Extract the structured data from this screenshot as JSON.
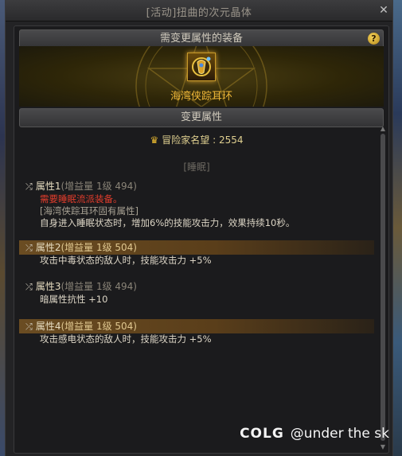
{
  "window": {
    "title": "[活动]扭曲的次元晶体",
    "close_icon": "close-x-icon"
  },
  "equip_section": {
    "header": "需变更属性的装备",
    "help_label": "?"
  },
  "item": {
    "name": "海湾侠踪耳环",
    "icon": "earring-icon",
    "name_color": "#f0b838"
  },
  "change_section": {
    "header": "变更属性"
  },
  "fame": {
    "label": "冒险家名望 : 2554",
    "icon": "fame-icon"
  },
  "sleep_tag": "[睡眠]",
  "attributes": [
    {
      "name": "属性1",
      "meta": "(增益量 1级 494)",
      "highlighted": false,
      "lines": [
        {
          "text": "需要睡眠流派装备。",
          "style": "red"
        },
        {
          "text": "[海湾侠踪耳环固有属性]",
          "style": "grey"
        },
        {
          "text": "自身进入睡眠状态时，增加6%的技能攻击力，效果持续10秒。",
          "style": "light"
        }
      ]
    },
    {
      "name": "属性2",
      "meta": "(增益量 1级 504)",
      "highlighted": true,
      "lines": [
        {
          "text": "攻击中毒状态的敌人时，技能攻击力 +5%",
          "style": "light"
        }
      ]
    },
    {
      "name": "属性3",
      "meta": "(增益量 1级 494)",
      "highlighted": false,
      "lines": [
        {
          "text": "暗属性抗性 +10",
          "style": "light"
        }
      ]
    },
    {
      "name": "属性4",
      "meta": "(增益量 1级 504)",
      "highlighted": true,
      "lines": [
        {
          "text": "攻击感电状态的敌人时，技能攻击力 +5%",
          "style": "light"
        }
      ]
    }
  ],
  "watermark": {
    "logo": "COLG",
    "handle": "@under the sk"
  },
  "colors": {
    "highlight": "#6a4c22",
    "warning": "#e03c2c",
    "gold": "#f0b838"
  }
}
